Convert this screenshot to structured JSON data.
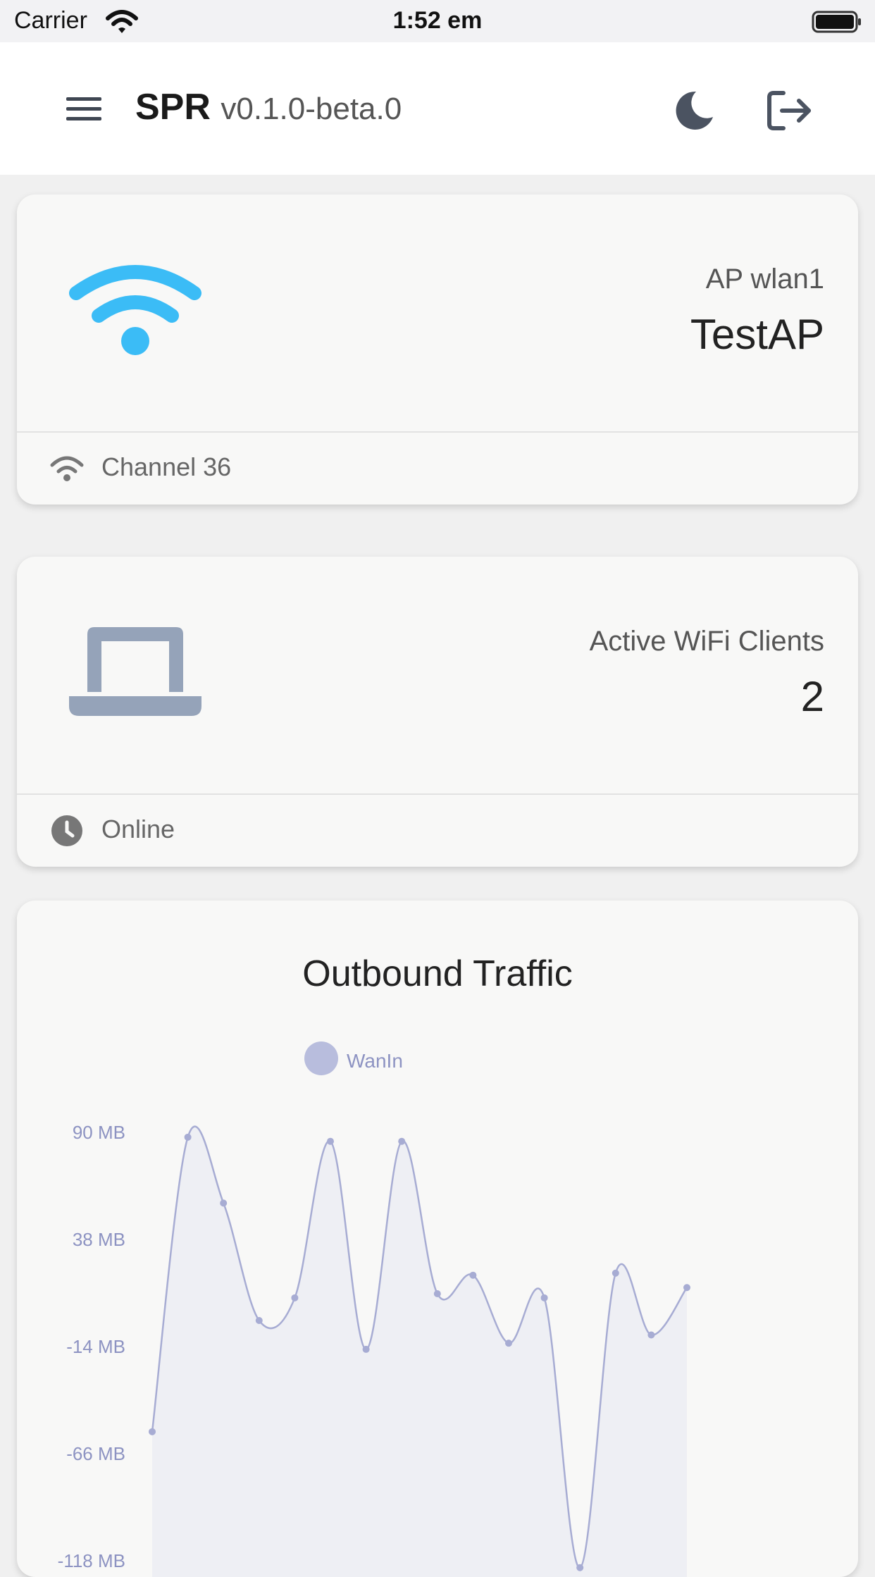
{
  "status_bar": {
    "carrier": "Carrier",
    "time": "1:52 em"
  },
  "header": {
    "title": "SPR",
    "version": "v0.1.0-beta.0",
    "icons": [
      "menu-icon",
      "moon-icon",
      "logout-icon"
    ]
  },
  "ap_card": {
    "icon": "wifi-icon",
    "icon_color": "#3bbcf6",
    "label": "AP wlan1",
    "value": "TestAP",
    "footer_icon": "wifi-icon",
    "footer_text": "Channel 36"
  },
  "clients_card": {
    "icon": "laptop-icon",
    "icon_color": "#95a3b9",
    "label": "Active WiFi Clients",
    "value": "2",
    "footer_icon": "clock-icon",
    "footer_text": "Online"
  },
  "traffic_card": {
    "title": "Outbound Traffic",
    "chart_data": {
      "type": "area",
      "title": "Outbound Traffic",
      "series": [
        {
          "name": "WanIn",
          "values": [
            -55,
            88,
            56,
            -1,
            10,
            86,
            -15,
            86,
            12,
            21,
            -12,
            10,
            -121,
            22,
            -8,
            15
          ]
        }
      ],
      "y_ticks": [
        "90 MB",
        "38 MB",
        "-14 MB",
        "-66 MB",
        "-118 MB"
      ],
      "y_tick_values": [
        90,
        38,
        -14,
        -66,
        -118
      ],
      "ylim": [
        -118,
        90
      ],
      "legend": "top-left",
      "line_color": "#a7acd3",
      "fill_color": "#eeeff4"
    }
  }
}
